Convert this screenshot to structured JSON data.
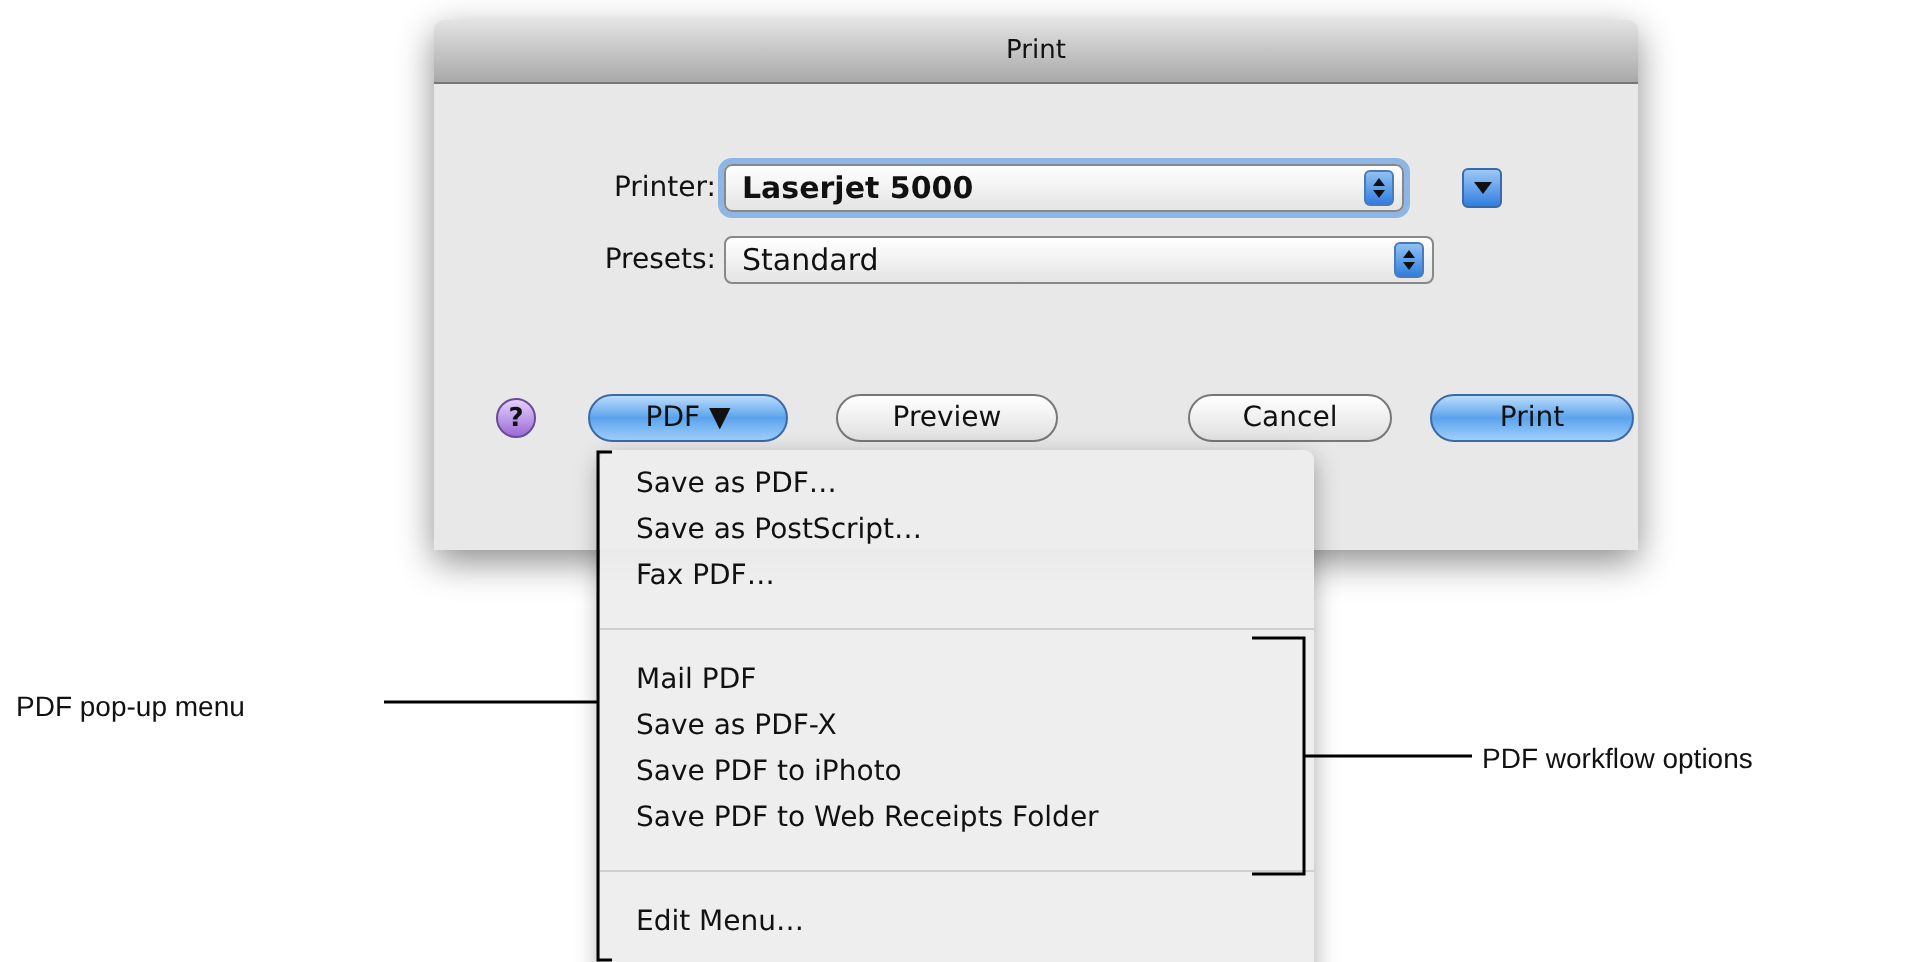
{
  "window": {
    "title": "Print"
  },
  "fields": [
    {
      "label": "Printer:",
      "value": "Laserjet 5000",
      "focused": true,
      "disclosure": true
    },
    {
      "label": "Presets:",
      "value": "Standard",
      "focused": false,
      "disclosure": false
    }
  ],
  "help": "?",
  "buttons": [
    {
      "label": "PDF ▼",
      "highlighted": true
    },
    {
      "label": "Preview",
      "highlighted": false
    },
    {
      "label": "Cancel",
      "highlighted": false
    },
    {
      "label": "Print",
      "highlighted": true
    }
  ],
  "menu": {
    "groups": [
      [
        "Save as PDF…",
        "Save as PostScript…",
        "Fax PDF…"
      ],
      [
        "Mail PDF",
        "Save as PDF-X",
        "Save PDF to iPhoto",
        "Save PDF to Web Receipts Folder"
      ],
      [
        "Edit Menu…"
      ]
    ]
  },
  "callouts": [
    {
      "label": "PDF pop-up menu",
      "kind": "left"
    },
    {
      "label": "PDF workflow options",
      "kind": "right"
    }
  ]
}
